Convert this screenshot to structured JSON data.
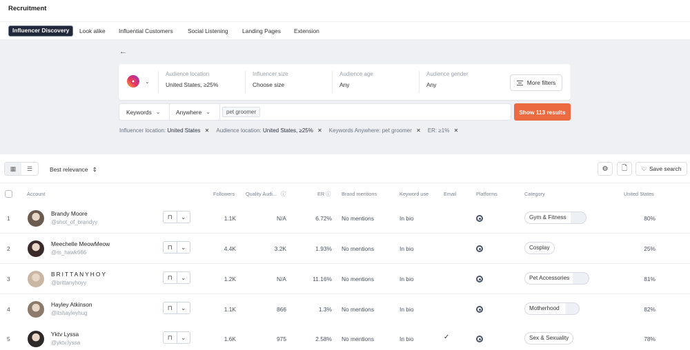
{
  "app": {
    "title": "Recruitment"
  },
  "tabs": [
    {
      "label": "Influencer Discovery",
      "active": true
    },
    {
      "label": "Look alike"
    },
    {
      "label": "Influential Customers"
    },
    {
      "label": "Social Listening"
    },
    {
      "label": "Landing Pages"
    },
    {
      "label": "Extension"
    }
  ],
  "filters": {
    "back": "←",
    "platform_icon": "instagram-icon",
    "groups": [
      {
        "label": "Audience location",
        "value": "United States, ≥25%"
      },
      {
        "label": "Influencer size",
        "value": "Choose size"
      },
      {
        "label": "Audience age",
        "value": "Any"
      },
      {
        "label": "Audience gender",
        "value": "Any"
      }
    ],
    "more_filters": "More filters"
  },
  "search": {
    "field": "Keywords",
    "scope": "Anywhere",
    "keyword": "pet groomer",
    "show_button": "Show 113 results"
  },
  "applied_filters": [
    {
      "label": "Influencer location:",
      "value": "United States"
    },
    {
      "label": "Audience location:",
      "value": "United States, ≥25%"
    },
    {
      "label": "Keywords Anywhere:",
      "value": "pet groomer"
    },
    {
      "label": "ER:",
      "value": "≥1%"
    }
  ],
  "toolbar": {
    "sort": "Best relevance",
    "save_search": "Save search"
  },
  "columns": {
    "account": "Account",
    "followers": "Followers",
    "quality": "Quality Audi...",
    "er": "ER",
    "brand": "Brand mentions",
    "keyword": "Keyword use",
    "email": "Email",
    "platforms": "Platforms",
    "category": "Category",
    "location": "United States"
  },
  "rows": [
    {
      "rank": "1",
      "name": "Brandy Moore",
      "handle": "@shot_of_brandyy",
      "followers": "1.1K",
      "quality": "N/A",
      "er": "6.72%",
      "brand": "No mentions",
      "keyword": "In bio",
      "email": "",
      "category": "Gym & Fitness",
      "location": "80%",
      "avatar_color": "#6b5a4e"
    },
    {
      "rank": "2",
      "name": "Meechelle MeowMeow",
      "handle": "@m_hawk666",
      "followers": "4.4K",
      "quality": "3.2K",
      "er": "1.93%",
      "brand": "No mentions",
      "keyword": "In bio",
      "email": "",
      "category": "Cosplay",
      "location": "25%",
      "avatar_color": "#3b2a2a"
    },
    {
      "rank": "3",
      "name": "BRITTANYHOY",
      "handle": "@brittanyhoyy",
      "followers": "1.2K",
      "quality": "N/A",
      "er": "11.16%",
      "brand": "No mentions",
      "keyword": "In bio",
      "email": "",
      "category": "Pet Accessories",
      "location": "81%",
      "avatar_color": "#c9b7a3"
    },
    {
      "rank": "4",
      "name": "Hayley Atkinson",
      "handle": "@itshayleyhug",
      "followers": "1.1K",
      "quality": "866",
      "er": "1.3%",
      "brand": "No mentions",
      "keyword": "In bio",
      "email": "",
      "category": "Motherhood",
      "location": "82%",
      "avatar_color": "#8c7a6a"
    },
    {
      "rank": "5",
      "name": "Yktv Lyssa",
      "handle": "@yktv.lyssa",
      "followers": "1.6K",
      "quality": "975",
      "er": "2.58%",
      "brand": "No mentions",
      "keyword": "In bio",
      "email": "✓",
      "category": "Sex & Sexuality",
      "location": "78%",
      "avatar_color": "#2e2a2a"
    }
  ]
}
